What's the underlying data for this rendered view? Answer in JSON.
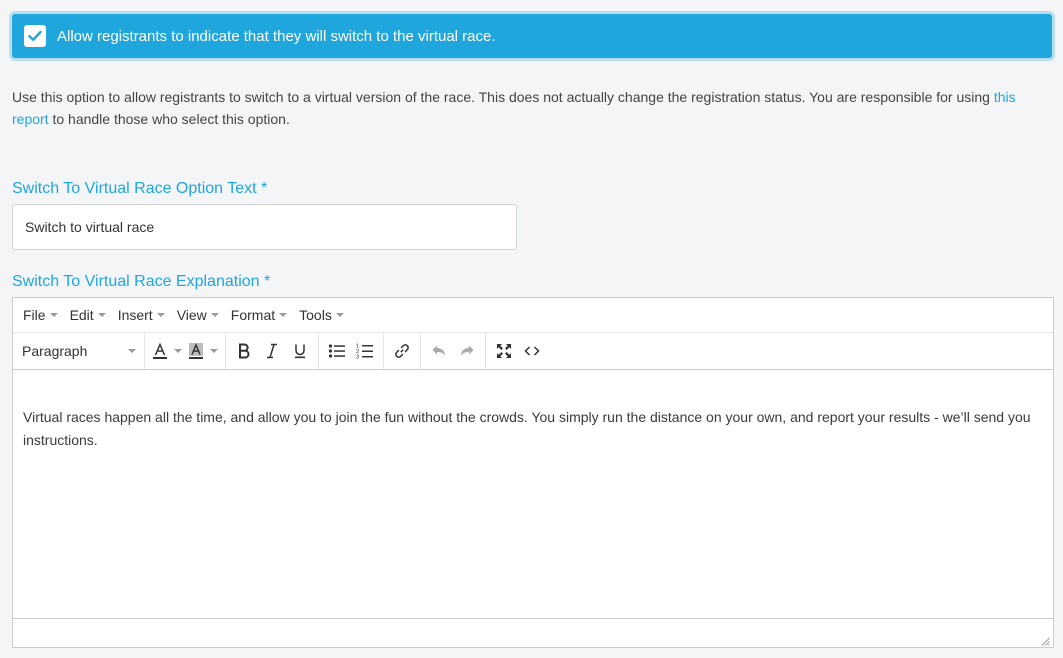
{
  "banner": {
    "checked": true,
    "label": "Allow registrants to indicate that they will switch to the virtual race."
  },
  "description": {
    "text_before": "Use this option to allow registrants to switch to a virtual version of the race. This does not actually change the registration status. You are responsible for using ",
    "link_text": "this report",
    "text_after": " to handle those who select this option."
  },
  "option_text_field": {
    "label": "Switch To Virtual Race Option Text *",
    "value": "Switch to virtual race"
  },
  "explanation_field": {
    "label": "Switch To Virtual Race Explanation *"
  },
  "editor": {
    "menus": [
      "File",
      "Edit",
      "Insert",
      "View",
      "Format",
      "Tools"
    ],
    "block_format": "Paragraph",
    "toolbar_icons": {
      "text_color": "text-color-icon",
      "background_color": "background-color-icon",
      "bold": "bold-icon",
      "italic": "italic-icon",
      "underline": "underline-icon",
      "bullet_list": "bullet-list-icon",
      "numbered_list": "numbered-list-icon",
      "link": "link-icon",
      "undo": "undo-icon",
      "redo": "redo-icon",
      "fullscreen": "fullscreen-icon",
      "source_code": "source-code-icon"
    },
    "content": "Virtual races happen all the time, and allow you to join the fun without the crowds. You simply run the distance on your own, and report your results - we’ll send you instructions."
  },
  "colors": {
    "accent": "#1fa6dd",
    "background": "#f4f5f7"
  }
}
